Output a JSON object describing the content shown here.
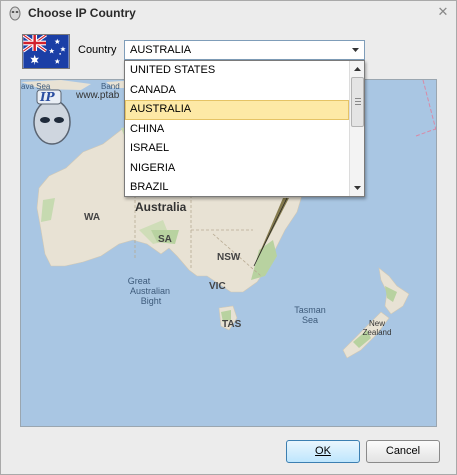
{
  "window": {
    "title": "Choose IP Country"
  },
  "country": {
    "label": "Country",
    "selected": "AUSTRALIA",
    "flag_icon": "australia-flag-icon"
  },
  "dropdown": {
    "options": [
      "UNITED STATES",
      "CANADA",
      "AUSTRALIA",
      "CHINA",
      "ISRAEL",
      "NIGERIA",
      "BRAZIL"
    ],
    "highlighted": "AUSTRALIA"
  },
  "map": {
    "labels": {
      "australia": "Australia",
      "wa": "WA",
      "sa": "SA",
      "nsw": "NSW",
      "vic": "VIC",
      "tas": "TAS",
      "bight_1": "Great",
      "bight_2": "Australian",
      "bight_3": "Bight",
      "tasman_1": "Tasman",
      "tasman_2": "Sea",
      "nz_1": "New",
      "nz_2": "Zealand",
      "java_sea": "ava Sea",
      "banda": "Band",
      "watermark": "www.ptab"
    },
    "logo_text": "IP"
  },
  "buttons": {
    "ok": "OK",
    "cancel": "Cancel"
  },
  "colors": {
    "water": "#a9c6e3",
    "land": "#e8e2d4",
    "forest": "#b8d2a0",
    "selection_bg": "#fde9a6",
    "ok_button": "#bee6fd"
  }
}
